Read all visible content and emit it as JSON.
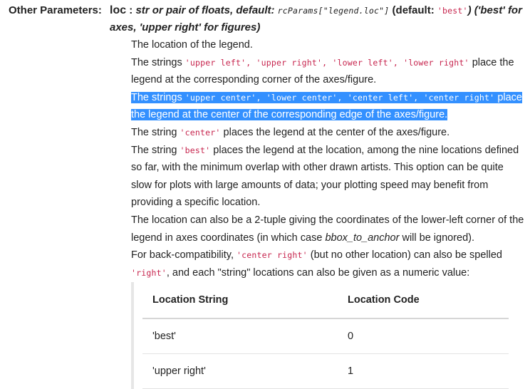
{
  "field": {
    "name": "Other Parameters:"
  },
  "signature": {
    "param": "loc",
    "sep": " : ",
    "type": "str or pair of floats, default:",
    "rcparam": "rcParams[\"legend.loc\"]",
    "default_pre": " (default: ",
    "default_val": "'best'",
    "default_post": ") ('best' for axes, 'upper right' for figures)"
  },
  "description": {
    "p1": "The location of the legend.",
    "p2_pre": "The strings ",
    "p2_codes": "'upper left', 'upper right', 'lower left', 'lower right'",
    "p2_post": " place the legend at the corresponding corner of the axes/figure.",
    "p3_pre": "The strings ",
    "p3_codes": "'upper center', 'lower center', 'center left', 'center right'",
    "p3_post": " place the legend at the center of the corresponding edge of the axes/figure.",
    "p4_pre": "The string ",
    "p4_code": "'center'",
    "p4_post": " places the legend at the center of the axes/figure.",
    "p5_pre": "The string ",
    "p5_code": "'best'",
    "p5_post": " places the legend at the location, among the nine locations defined so far, with the minimum overlap with other drawn artists. This option can be quite slow for plots with large amounts of data; your plotting speed may benefit from providing a specific location.",
    "p6_pre": "The location can also be a 2-tuple giving the coordinates of the lower-left corner of the legend in axes coordinates (in which case ",
    "p6_em": "bbox_to_anchor",
    "p6_post": " will be ignored).",
    "p7_pre": "For back-compatibility, ",
    "p7_code1": "'center right'",
    "p7_mid": " (but no other location) can also be spelled ",
    "p7_code2": "'right'",
    "p7_post": ", and each \"string\" locations can also be given as a numeric value:"
  },
  "table": {
    "headers": [
      "Location String",
      "Location Code"
    ],
    "rows": [
      [
        "'best'",
        "0"
      ],
      [
        "'upper right'",
        "1"
      ]
    ]
  }
}
